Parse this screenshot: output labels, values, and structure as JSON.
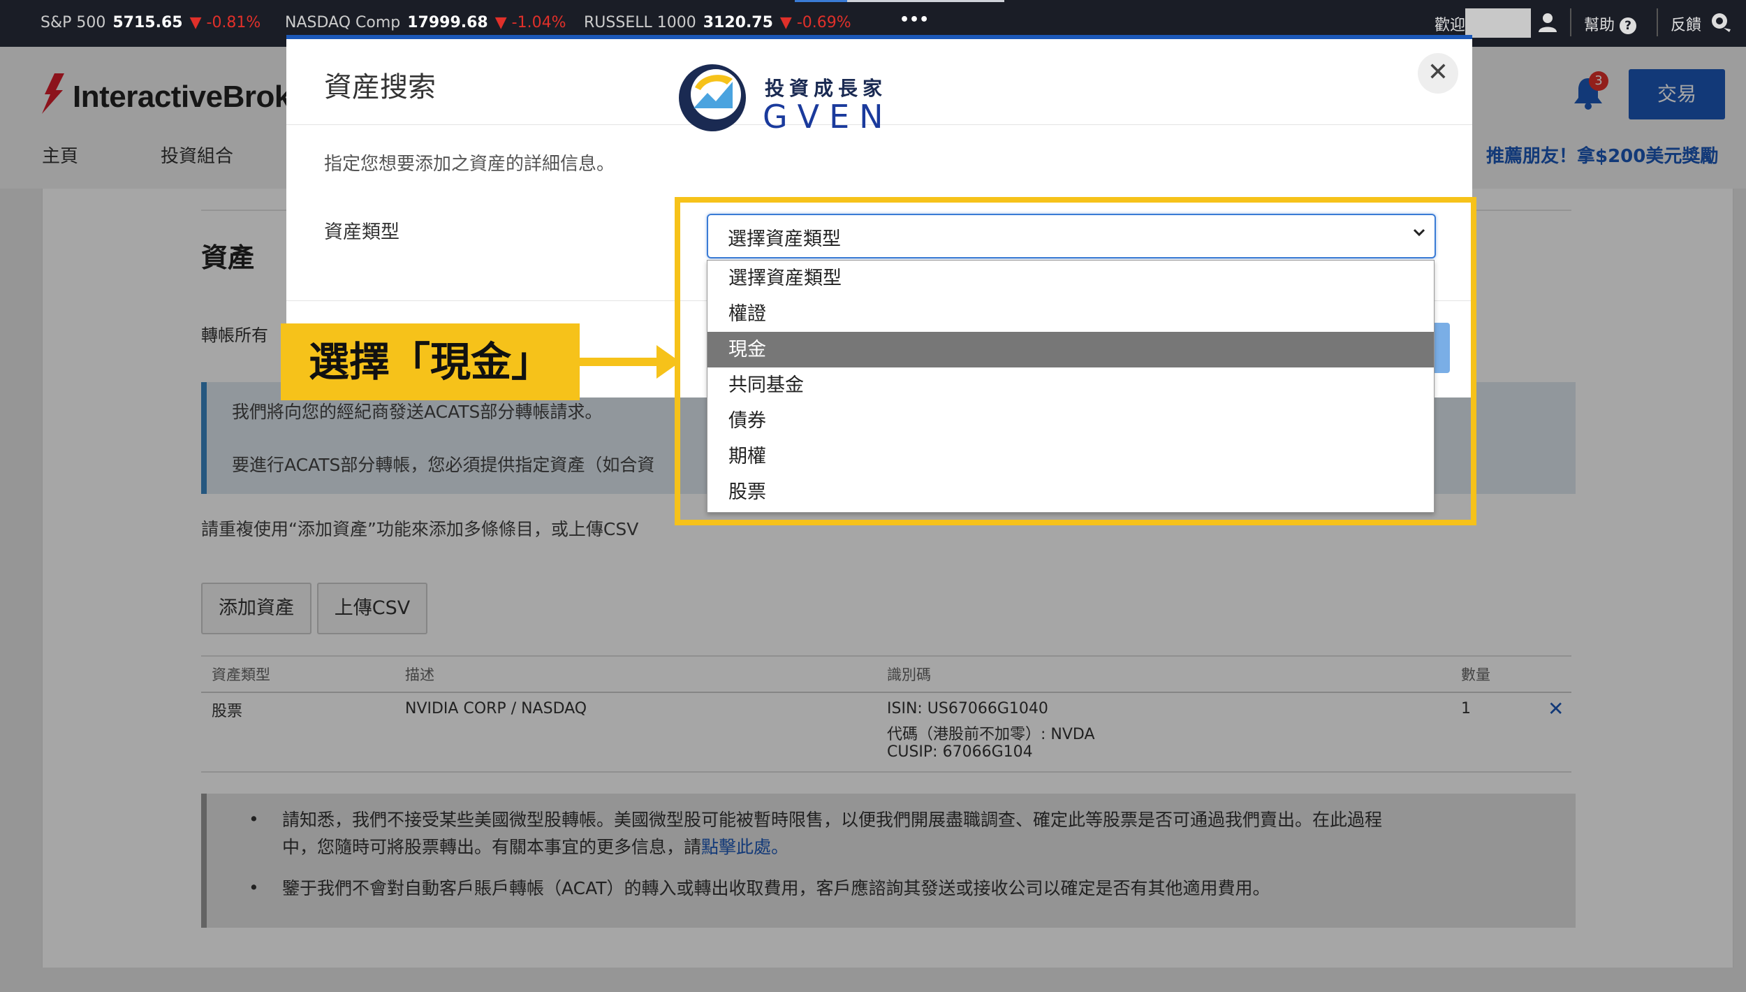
{
  "ticker": {
    "items": [
      {
        "name": "S&P 500",
        "value": "5715.65",
        "change": "-0.81%"
      },
      {
        "name": "NASDAQ Comp",
        "value": "17999.68",
        "change": "-1.04%"
      },
      {
        "name": "RUSSELL 1000",
        "value": "3120.75",
        "change": "-0.69%"
      }
    ],
    "more": "•••",
    "welcome": "歡迎",
    "help": "幫助",
    "feedback": "反饋",
    "progress": 0.25
  },
  "header": {
    "logo_text": "InteractiveBrok",
    "nav": [
      "主頁",
      "投資組合"
    ],
    "notification_count": "3",
    "trade_button": "交易",
    "referral": "推薦朋友！拿$200美元獎勵"
  },
  "page": {
    "section_title": "資產",
    "transfer_label": "轉帳所有",
    "info_line1": "我們將向您的經紀商發送ACATS部分轉帳請求。",
    "info_line2": "要進行ACATS部分轉帳，您必須提供指定資產（如合資",
    "repeat_text": "請重複使用“添加資產”功能來添加多條條目，或上傳CSV",
    "add_asset_button": "添加資產",
    "upload_csv_button": "上傳CSV",
    "table": {
      "headers": [
        "資產類型",
        "描述",
        "識別碼",
        "數量"
      ],
      "rows": [
        {
          "type": "股票",
          "description": "NVIDIA CORP / NASDAQ",
          "id_lines": [
            "ISIN: US67066G1040",
            "代碼（港股前不加零）: NVDA",
            "CUSIP: 67066G104"
          ],
          "quantity": "1",
          "remove": "✕"
        }
      ]
    },
    "notes": {
      "note1_line1": "請知悉，我們不接受某些美國微型股轉帳。美國微型股可能被暫時限售，以便我們開展盡職調查、確定此等股票是否可通過我們賣出。在此過程",
      "note1_line2_prefix": "中，您隨時可將股票轉出。有關本事宜的更多信息，請",
      "note1_link": "點擊此處",
      "note1_suffix": "。",
      "note2": "鑒于我們不會對自動客戶賬戶轉帳（ACAT）的轉入或轉出收取費用，客戶應諮詢其發送或接收公司以確定是否有其他適用費用。"
    }
  },
  "modal": {
    "title": "資産搜索",
    "close": "✕",
    "description": "指定您想要添加之資産的詳細信息。",
    "asset_type_label": "資産類型",
    "select_value": "選擇資産類型",
    "options": [
      "選擇資産類型",
      "權證",
      "現金",
      "共同基金",
      "債券",
      "期權",
      "股票"
    ],
    "highlighted_option": "現金"
  },
  "brand": {
    "cn": "投資成長家",
    "en": "GVEN"
  },
  "annotation": {
    "callout": "選擇「現金」",
    "highlight_color": "#f6c21a"
  },
  "colors": {
    "accent": "#1c58b8",
    "ticker_bg": "#1a1d26",
    "negative": "#e0302a"
  }
}
